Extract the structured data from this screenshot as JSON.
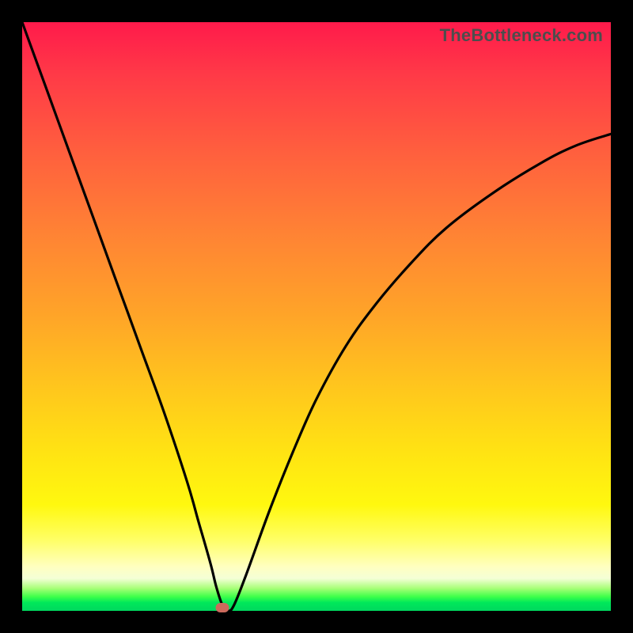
{
  "watermark": "TheBottleneck.com",
  "colors": {
    "frame": "#000000",
    "curve": "#000000",
    "marker": "#cc6a5c",
    "gradient_top": "#ff1a4b",
    "gradient_bottom": "#00d85e"
  },
  "chart_data": {
    "type": "line",
    "title": "",
    "xlabel": "",
    "ylabel": "",
    "xlim": [
      0,
      100
    ],
    "ylim": [
      0,
      100
    ],
    "grid": false,
    "legend": false,
    "series": [
      {
        "name": "bottleneck-curve",
        "x": [
          0,
          4,
          8,
          12,
          16,
          20,
          24,
          28,
          30,
          32,
          33,
          34,
          35,
          36,
          38,
          42,
          46,
          50,
          55,
          60,
          66,
          72,
          80,
          88,
          94,
          100
        ],
        "y": [
          100,
          89,
          78,
          67,
          56,
          45,
          34,
          22,
          15,
          8,
          4,
          1,
          0,
          1,
          6,
          17,
          27,
          36,
          45,
          52,
          59,
          65,
          71,
          76,
          79,
          81
        ]
      }
    ],
    "annotations": [
      {
        "name": "min-marker",
        "x": 34,
        "y": 0.5
      }
    ]
  }
}
